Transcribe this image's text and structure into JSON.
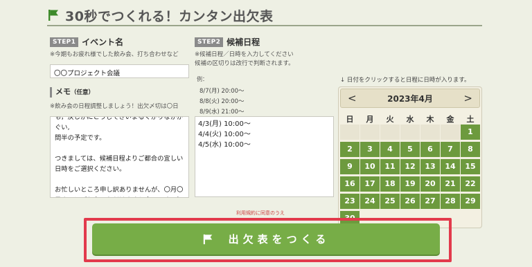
{
  "header": {
    "title": "30秒でつくれる！カンタン出欠表",
    "icon": "flag-icon"
  },
  "step1": {
    "tag": "STEP1",
    "title": "イベント名",
    "note": "※今期もお疲れ様でした飲み会、打ち合わせなど",
    "value": "〇〇プロジェクト会議"
  },
  "memo": {
    "heading": "メモ",
    "heading_small": "（任意）",
    "note": "※飲み会の日程調整しましょう！出欠〆切は〇日",
    "text": "も，決しかにとうじてきいまるくかりなかかぐい,\n問半の予定です。\n\nつきましては、候補日程よりご都合の宜しい\n日時をご選択ください。\n\nお忙しいところ申し訳ありませんが、〇月〇\n日までにご入力いただけますと幸いです。何\n卒よろしくお願いいたします。"
  },
  "step2": {
    "tag": "STEP2",
    "title": "候補日程",
    "note1": "※候補日程／日時を入力してください",
    "note2": "候補の区切りは改行で判断されます。",
    "example_label": "例：",
    "examples": [
      "8/7(月) 20:00〜",
      "8/8(火) 20:00〜",
      "8/9(水) 21:00〜"
    ],
    "value": "4/3(月) 10:00〜\n4/4(火) 10:00〜\n4/5(水) 10:00〜"
  },
  "calendar": {
    "note": "↓ 日付をクリックすると日程に日時が入ります。",
    "prev": "<",
    "next": ">",
    "month": "2023年4月",
    "weekdays": [
      "日",
      "月",
      "火",
      "水",
      "木",
      "金",
      "土"
    ],
    "days": [
      "1",
      "2",
      "3",
      "4",
      "5",
      "6",
      "7",
      "8",
      "9",
      "10",
      "11",
      "12",
      "13",
      "14",
      "15",
      "16",
      "17",
      "18",
      "19",
      "20",
      "21",
      "22",
      "23",
      "24",
      "25",
      "26",
      "27",
      "28",
      "29",
      "30"
    ]
  },
  "terms": "利用規約に同意のうえ",
  "submit": {
    "label": "出欠表をつくる",
    "icon": "flag-icon"
  },
  "colors": {
    "accent": "#77ad47",
    "day": "#6d9a3e",
    "highlight": "#e23a4c"
  }
}
